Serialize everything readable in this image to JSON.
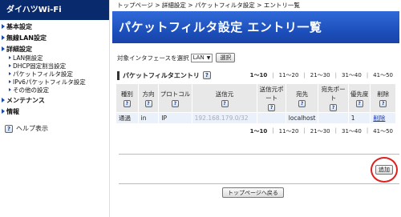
{
  "brand": "ダイハツWi-Fi",
  "sidebar": {
    "items": [
      {
        "label": "基本設定"
      },
      {
        "label": "無線LAN設定"
      },
      {
        "label": "詳細設定"
      }
    ],
    "sub_items": [
      {
        "label": "LAN側設定"
      },
      {
        "label": "DHCP固定割当設定"
      },
      {
        "label": "パケットフィルタ設定"
      },
      {
        "label": "IPv6パケットフィルタ設定"
      },
      {
        "label": "その他の設定"
      }
    ],
    "items_after": [
      {
        "label": "メンテナンス"
      },
      {
        "label": "情報"
      }
    ],
    "help": "ヘルプ表示"
  },
  "breadcrumb": "トップページ > 詳細設定 > パケットフィルタ設定 > エントリ一覧",
  "page_title": "パケットフィルタ設定 エントリ一覧",
  "interface": {
    "label": "対象インタフェースを選択",
    "selected": "LAN",
    "button": "選択"
  },
  "entry_section": {
    "title": "パケットフィルタエントリ",
    "help_icon": "?"
  },
  "pager": [
    "1～10",
    "11～20",
    "21～30",
    "31～40",
    "41～50"
  ],
  "table": {
    "headers": [
      "種別",
      "方向",
      "プロトコル",
      "送信元",
      "送信元ポート",
      "宛先",
      "宛先ポート",
      "優先度",
      "削除"
    ],
    "rows": [
      {
        "type": "通過",
        "direction": "in",
        "protocol": "IP",
        "source": "192.168.179.0/32",
        "source_port": "",
        "dest": "localhost",
        "dest_port": "",
        "priority": "1",
        "delete": "削除"
      }
    ]
  },
  "add_button": "追加",
  "top_button": "トップページへ戻る",
  "colors": {
    "accent": "#1b4cb8",
    "brand_bg": "#0a2a6e",
    "highlight": "#e02020"
  }
}
